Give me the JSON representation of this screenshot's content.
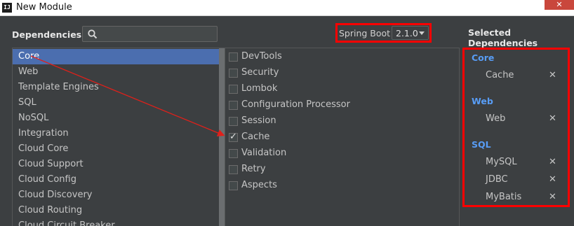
{
  "window": {
    "title": "New Module",
    "icon_text": "IJ",
    "close_label": "✕"
  },
  "header": {
    "dependencies_label": "Dependencies",
    "search": {
      "value": "",
      "placeholder": ""
    },
    "spring_boot_label": "Spring Boot",
    "spring_boot_version": "2.1.0"
  },
  "selected_dependencies_title": "Selected Dependencies",
  "categories": [
    {
      "label": "Core",
      "selected": true
    },
    {
      "label": "Web"
    },
    {
      "label": "Template Engines"
    },
    {
      "label": "SQL"
    },
    {
      "label": "NoSQL"
    },
    {
      "label": "Integration"
    },
    {
      "label": "Cloud Core"
    },
    {
      "label": "Cloud Support"
    },
    {
      "label": "Cloud Config"
    },
    {
      "label": "Cloud Discovery"
    },
    {
      "label": "Cloud Routing"
    },
    {
      "label": "Cloud Circuit Breaker"
    }
  ],
  "dependencies": [
    {
      "label": "DevTools",
      "checked": false
    },
    {
      "label": "Security",
      "checked": false
    },
    {
      "label": "Lombok",
      "checked": false
    },
    {
      "label": "Configuration Processor",
      "checked": false
    },
    {
      "label": "Session",
      "checked": false
    },
    {
      "label": "Cache",
      "checked": true
    },
    {
      "label": "Validation",
      "checked": false
    },
    {
      "label": "Retry",
      "checked": false
    },
    {
      "label": "Aspects",
      "checked": false
    }
  ],
  "selected_groups": [
    {
      "group": "Core",
      "items": [
        "Cache"
      ]
    },
    {
      "group": "Web",
      "items": [
        "Web"
      ]
    },
    {
      "group": "SQL",
      "items": [
        "MySQL",
        "JDBC",
        "MyBatis"
      ]
    }
  ],
  "remove_icon": "✕",
  "check_icon": "✓",
  "colors": {
    "highlight_border": "#ff0000",
    "selection": "#4b6eaf",
    "group_label": "#589df6",
    "background": "#3c3f41"
  }
}
